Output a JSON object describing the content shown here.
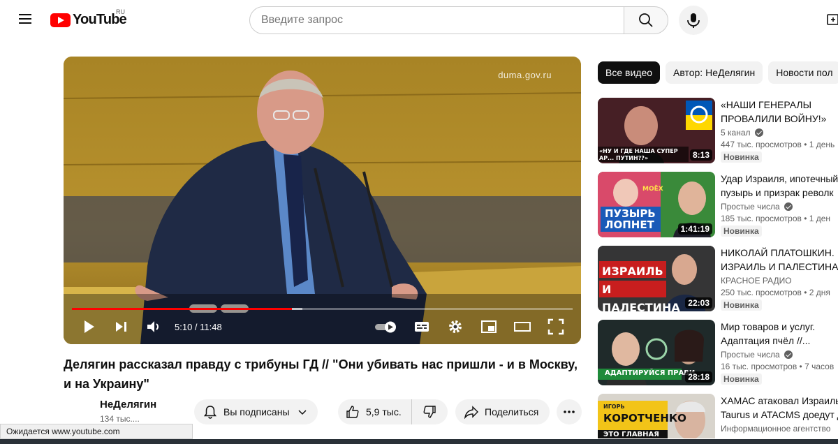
{
  "header": {
    "logo_text": "YouTube",
    "country_code": "RU",
    "search_placeholder": "Введите запрос"
  },
  "player": {
    "watermark": "duma.gov.ru",
    "time_display": "5:10 / 11:48",
    "progress_fraction": 0.44,
    "buffered_fraction": 0.46
  },
  "video": {
    "title": "Делягин рассказал правду с трибуны ГД // \"Они убивать нас пришли - и в Москву, и на Украину\"",
    "channel_name": "НеДелягин",
    "subscribers": "134 тыс....",
    "subscribe_label": "Вы подписаны",
    "likes": "5,9 тыс.",
    "share_label": "Поделиться"
  },
  "status_bar": {
    "text": "Ожидается www.youtube.com"
  },
  "sidebar": {
    "chips": [
      "Все видео",
      "Автор: НеДелягин",
      "Новости пол"
    ],
    "recommendations": [
      {
        "title_line1": "«НАШИ ГЕНЕРАЛЫ",
        "title_line2": "ПРОВАЛИЛИ ВОЙНУ!»",
        "channel": "5 канал",
        "verified": true,
        "views": "447 тыс. просмотров",
        "age": "1 день",
        "badge": "Новинка",
        "duration": "8:13",
        "thumb_caption": "«НУ И ГДЕ НАША СУПЕР АР... ПУТИН??»"
      },
      {
        "title_line1": "Удар Израиля, ипотечный",
        "title_line2": "пузырь и призрак револк",
        "channel": "Простые числа",
        "verified": true,
        "views": "185 тыс. просмотров",
        "age": "1 ден",
        "badge": "Новинка",
        "duration": "1:41:19",
        "thumb_caption_top": "МОЁХ",
        "thumb_caption": "ПУЗЫРЬ ЛОПНЕТ"
      },
      {
        "title_line1": "НИКОЛАЙ ПЛАТОШКИН.",
        "title_line2": "ИЗРАИЛЬ И ПАЛЕСТИНА.",
        "channel": "КРАСНОЕ РАДИО",
        "verified": false,
        "views": "250 тыс. просмотров",
        "age": "2 дня",
        "badge": "Новинка",
        "duration": "22:03",
        "thumb_caption": "ИЗРАИЛЬ И ПАЛЕСТИНА"
      },
      {
        "title_line1": "Мир товаров и услуг.",
        "title_line2": "Адаптация пчёл //...",
        "channel": "Простые числа",
        "verified": true,
        "views": "16 тыс. просмотров",
        "age": "7 часов",
        "badge": "Новинка",
        "duration": "28:18",
        "thumb_caption": "АДАПТИРУЙСЯ ПРАВИ"
      },
      {
        "title_line1": "ХАМАС атаковал Израиль",
        "title_line2": "Taurus и ATACMS доедут д",
        "channel": "Информационное агентство",
        "verified": false,
        "views": "",
        "age": "",
        "badge": "",
        "duration": "",
        "thumb_caption_top": "ИГОРЬ",
        "thumb_caption": "КОРОТЧЕНКО",
        "thumb_caption_bottom": "ЭТО ГЛАВНАЯ"
      }
    ]
  },
  "colors": {
    "brand_red": "#ff0000",
    "chip_active": "#0f0f0f",
    "pill_bg": "#f2f2f2"
  }
}
